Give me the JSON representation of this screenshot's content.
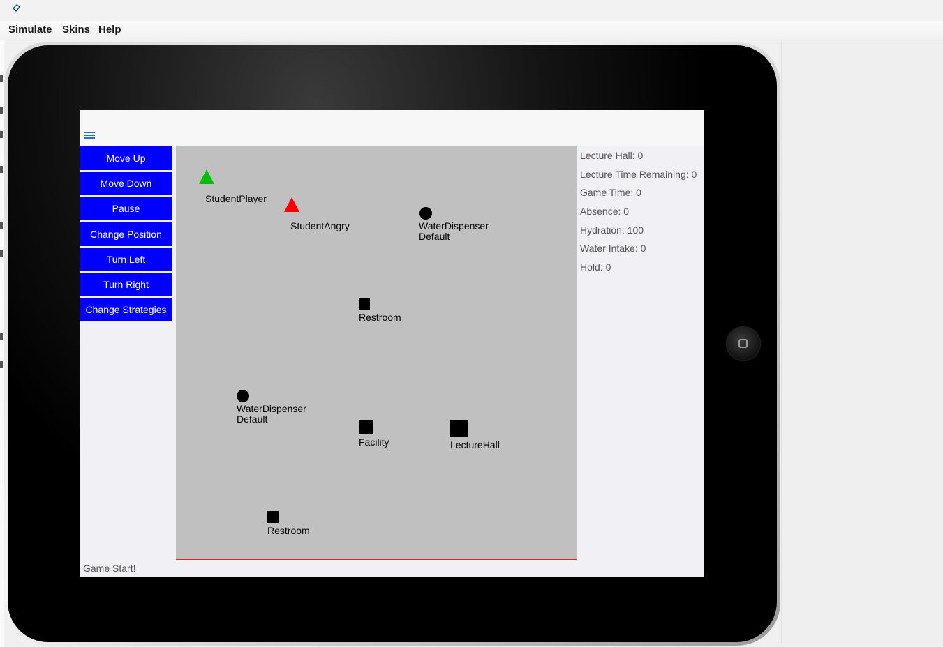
{
  "menu": [
    "Simulate",
    "Skins",
    "Help"
  ],
  "toolbar": {
    "menu_icon": "hamburger-icon"
  },
  "buttons": [
    "Move Up",
    "Move Down",
    "Pause",
    "Change Position",
    "Turn Left",
    "Turn Right",
    "Change Strategies"
  ],
  "map": {
    "objects": [
      {
        "type": "triangle",
        "color": "#00c000",
        "label": "StudentPlayer"
      },
      {
        "type": "triangle",
        "color": "#ff0000",
        "label": "StudentAngry"
      },
      {
        "type": "circle",
        "color": "#000000",
        "label": "WaterDispenser\nDefault"
      },
      {
        "type": "square",
        "color": "#000000",
        "label": "Restroom"
      },
      {
        "type": "circle",
        "color": "#000000",
        "label": "WaterDispenser\nDefault"
      },
      {
        "type": "square",
        "color": "#000000",
        "label": "Facility"
      },
      {
        "type": "square",
        "color": "#000000",
        "label": "LectureHall"
      },
      {
        "type": "square",
        "color": "#000000",
        "label": "Restroom"
      }
    ]
  },
  "stats": [
    "Lecture Hall: 0",
    "Lecture Time Remaining: 0",
    "Game Time: 0",
    "Absence: 0",
    "Hydration: 100",
    "Water Intake: 0",
    "Hold: 0"
  ],
  "status": "Game Start!",
  "colors": {
    "button_bg": "#0000ff",
    "map_bg": "#c0c0c0",
    "map_border": "#e02020"
  }
}
